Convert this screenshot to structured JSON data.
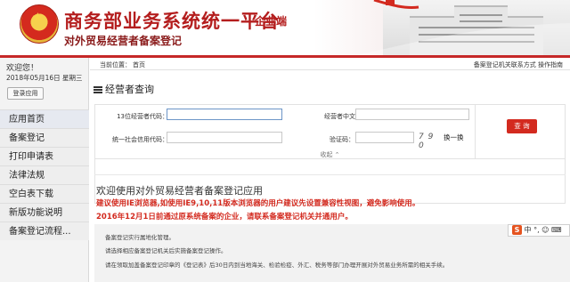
{
  "header": {
    "title": "商务部业务系统统一平台",
    "tag": "企业端",
    "subtitle": "对外贸易经营者备案登记"
  },
  "sidebar": {
    "welcome": "欢迎您！",
    "date": "2018年05月16日 星期三",
    "login_button": "登录应用",
    "items": [
      {
        "label": "应用首页"
      },
      {
        "label": "备案登记"
      },
      {
        "label": "打印申请表"
      },
      {
        "label": "法律法规"
      },
      {
        "label": "空白表下载"
      },
      {
        "label": "新版功能说明"
      },
      {
        "label": "备案登记流程..."
      }
    ]
  },
  "breadcrumb": {
    "label": "当前位置：",
    "current": "首页",
    "right": "备案登记机关联系方式  操作指南"
  },
  "search": {
    "section_title": "经营者查询",
    "fields": {
      "org_code_label": "13位经营者代码：",
      "org_code_value": "",
      "name_label": "经营者中文名称：",
      "name_value": "",
      "credit_code_label": "统一社会信用代码：",
      "credit_code_value": "",
      "captcha_label": "验证码：",
      "captcha_value": ""
    },
    "captcha_image_text": "7 9 0",
    "captcha_refresh": "换一换",
    "query_button": "查 询",
    "collapse": "收起 ⌃"
  },
  "content": {
    "welcome_heading": "欢迎使用对外贸易经营者备案登记应用",
    "warning_1": "建议使用IE浏览器,如使用IE9,10,11版本浏览器的用户建议先设置兼容性视图，避免影响使用。",
    "warning_2": "2016年12月1日前通过原系统备案的企业，请联系备案登记机关并通用户。",
    "notice_lines": [
      "备案登记实行属地化管理。",
      "请选择相应备案登记机关后实施备案登记操作。",
      "请在领取加盖备案登记印章的《登记表》后30日内到当地海关、检验检疫、外汇、税务等部门办理开展对外贸易业务所需的相关手续。"
    ],
    "ime_bar": "中 °, ☺ ⌨"
  },
  "colors": {
    "brand_red": "#d32a1f",
    "title_red": "#b41e1e",
    "sidebar_bg": "#f3f3f3"
  }
}
